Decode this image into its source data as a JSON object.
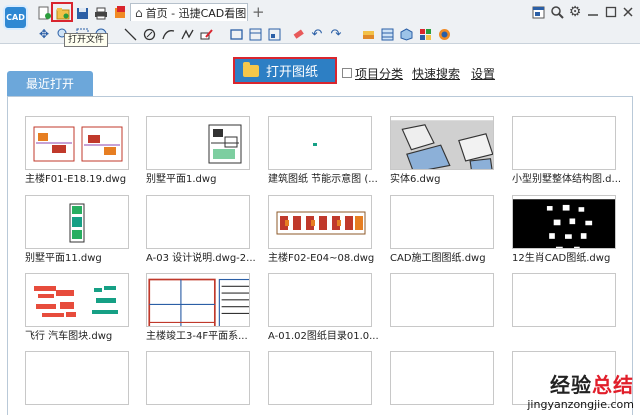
{
  "app": {
    "logo_text": "CAD",
    "tab_label": "首页 - 迅捷CAD看图",
    "tab_plus": "+",
    "tooltip": "打开文件"
  },
  "toolbar": {
    "row1": [
      "new-file-icon",
      "open-file-icon",
      "save-icon",
      "print-icon",
      "batch-icon"
    ],
    "row2": [
      "move-icon",
      "zoom-icon",
      "zoom-window-icon",
      "pan-icon",
      "line-icon",
      "circle-icon",
      "arc-icon",
      "polyline-icon",
      "eraser-icon",
      "rectangle-icon",
      "layout-icon",
      "edit-icon",
      "undo-icon",
      "redo-icon",
      "layers-icon",
      "stack-icon",
      "3d-view-icon",
      "color-icon",
      "palette-icon"
    ],
    "right": [
      "window-icon",
      "search-icon",
      "gear-icon",
      "minimize-icon",
      "maximize-icon",
      "close-icon"
    ]
  },
  "main": {
    "recent_tab": "最近打开",
    "open_button": "打开图纸",
    "project_classify": "项目分类",
    "quick_search": "快速搜索",
    "settings": "设置"
  },
  "files": [
    {
      "name": "主楼F01-E18.19.dwg",
      "thumb": "plan-pair"
    },
    {
      "name": "别墅平面1.dwg",
      "thumb": "plan-sheet"
    },
    {
      "name": "建筑图纸 节能示意图 (...",
      "thumb": "dot"
    },
    {
      "name": "实体6.dwg",
      "thumb": "solid-3d"
    },
    {
      "name": "小型别墅整体结构图.d...",
      "thumb": "blank"
    },
    {
      "name": "别墅平面11.dwg",
      "thumb": "green-plan"
    },
    {
      "name": "A-03 设计说明.dwg-2...",
      "thumb": "blank"
    },
    {
      "name": "主楼F02-E04~08.dwg",
      "thumb": "elevation"
    },
    {
      "name": "CAD施工图图纸.dwg",
      "thumb": "blank"
    },
    {
      "name": "12生肖CAD图纸.dwg",
      "thumb": "zodiac"
    },
    {
      "name": "飞行 汽车图块.dwg",
      "thumb": "blocks"
    },
    {
      "name": "主楼竣工3-4F平面系...",
      "thumb": "floor-plan"
    },
    {
      "name": "A-01.02图纸目录01.0...",
      "thumb": "blank"
    },
    {
      "name": "",
      "thumb": "blank"
    },
    {
      "name": "",
      "thumb": "blank"
    },
    {
      "name": "",
      "thumb": "blank"
    },
    {
      "name": "",
      "thumb": "blank"
    },
    {
      "name": "",
      "thumb": "blank"
    },
    {
      "name": "",
      "thumb": "blank"
    },
    {
      "name": "",
      "thumb": "blank"
    }
  ],
  "watermark": {
    "title_black": "经验",
    "title_red": "总结",
    "url": "jingyanzongjie.com"
  }
}
